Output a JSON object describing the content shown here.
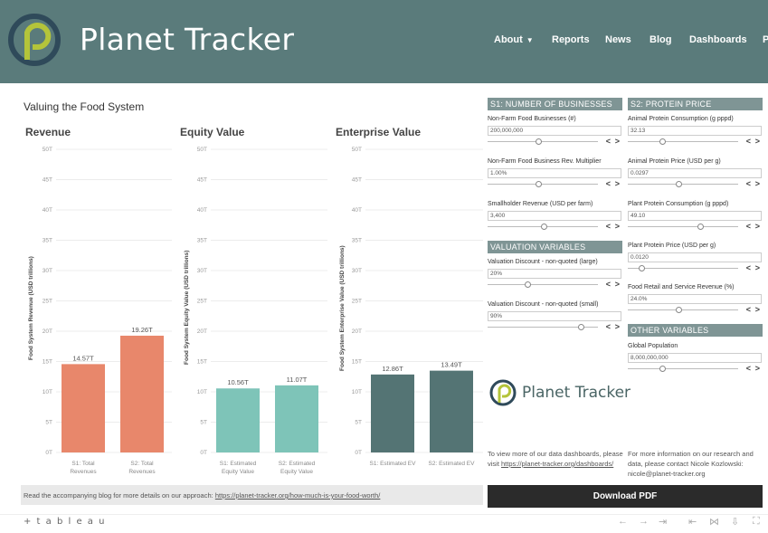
{
  "header": {
    "brand": "Planet Tracker",
    "nav": [
      {
        "label": "About",
        "has_caret": true
      },
      {
        "label": "Reports"
      },
      {
        "label": "News"
      },
      {
        "label": "Blog"
      },
      {
        "label": "Dashboards"
      },
      {
        "label": "P"
      }
    ],
    "colors": {
      "background": "#5a7b7b",
      "logo_green": "#b4c43a",
      "logo_ring": "#2f4a5a"
    }
  },
  "dashboard": {
    "title": "Valuing the Food System",
    "charts": [
      {
        "title": "Revenue",
        "ylabel": "Food System Revenue (USD trillions)"
      },
      {
        "title": "Equity Value",
        "ylabel": "Food System Equity Value (USD trillions)"
      },
      {
        "title": "Enterprise Value",
        "ylabel": "Food System Enterprise Value (USD trillions)"
      }
    ],
    "footer_text": "Read the accompanying blog for more details on our approach:",
    "footer_link": "https://planet-tracker.org/how-much-is-your-food-worth/"
  },
  "chart_data": [
    {
      "type": "bar",
      "title": "Revenue",
      "ylabel": "Food System Revenue (USD trillions)",
      "categories": [
        "S1: Total Revenues",
        "S2: Total Revenues"
      ],
      "values": [
        14.57,
        19.26
      ],
      "value_labels": [
        "14.57T",
        "19.26T"
      ],
      "yticks": [
        "0T",
        "5T",
        "10T",
        "15T",
        "20T",
        "25T",
        "30T",
        "35T",
        "40T",
        "45T",
        "50T"
      ],
      "ylim": [
        0,
        50
      ],
      "color": "#e8876b"
    },
    {
      "type": "bar",
      "title": "Equity Value",
      "ylabel": "Food System Equity Value (USD trillions)",
      "categories": [
        "S1: Estimated Equity Value",
        "S2: Estimated Equity Value"
      ],
      "values": [
        10.56,
        11.07
      ],
      "value_labels": [
        "10.56T",
        "11.07T"
      ],
      "yticks": [
        "0T",
        "5T",
        "10T",
        "15T",
        "20T",
        "25T",
        "30T",
        "35T",
        "40T",
        "45T",
        "50T"
      ],
      "ylim": [
        0,
        50
      ],
      "color": "#7ec4b8"
    },
    {
      "type": "bar",
      "title": "Enterprise Value",
      "ylabel": "Food System Enterprise Value (USD trillions)",
      "categories": [
        "S1: Estimated EV",
        "S2: Estimated EV"
      ],
      "values": [
        12.86,
        13.49
      ],
      "value_labels": [
        "12.86T",
        "13.49T"
      ],
      "yticks": [
        "0T",
        "5T",
        "10T",
        "15T",
        "20T",
        "25T",
        "30T",
        "35T",
        "40T",
        "45T",
        "50T"
      ],
      "ylim": [
        0,
        50
      ],
      "color": "#547474"
    }
  ],
  "panel": {
    "s1_header": "S1: NUMBER OF BUSINESSES",
    "s2_header": "S2: PROTEIN PRICE",
    "valuation_header": "VALUATION VARIABLES",
    "other_header": "OTHER VARIABLES",
    "params": [
      {
        "label": "Non-Farm Food Businesses (#)",
        "value": "200,000,000",
        "level": 0.45
      },
      {
        "label": "Non-Farm Food Business Rev. Multiplier",
        "value": "1.00%",
        "level": 0.45
      },
      {
        "label": "Smallholder Revenue (USD per farm)",
        "value": "3,400",
        "level": 0.5
      },
      {
        "label": "Valuation Discount - non-quoted (large)",
        "value": "20%",
        "level": 0.35
      },
      {
        "label": "Valuation Discount - non-quoted (small)",
        "value": "90%",
        "level": 0.85
      },
      {
        "label": "Animal Protein Consumption (g pppd)",
        "value": "32.13",
        "level": 0.3
      },
      {
        "label": "Animal Protein Price (USD per g)",
        "value": "0.0297",
        "level": 0.45
      },
      {
        "label": "Plant Protein Consumption (g pppd)",
        "value": "49.10",
        "level": 0.65
      },
      {
        "label": "Plant Protein Price (USD per g)",
        "value": "0.0120",
        "level": 0.1
      },
      {
        "label": "Food Retail and Service Revenue (%)",
        "value": "24.0%",
        "level": 0.45
      },
      {
        "label": "Global Population",
        "value": "8,000,000,000",
        "level": 0.3
      }
    ],
    "stepper_prev": "<",
    "stepper_next": ">",
    "logo_text": "Planet Tracker",
    "info_left": "To view more of our data dashboards, please visit",
    "info_left_link": "https://planet-tracker.org/dashboards/",
    "info_right": "For more information on our research and data, please contact Nicole Kozlowski:",
    "info_right_email": "nicole@planet-tracker.org",
    "download_label": "Download PDF"
  },
  "tableau": {
    "logo": "+ t a b l e a u"
  }
}
